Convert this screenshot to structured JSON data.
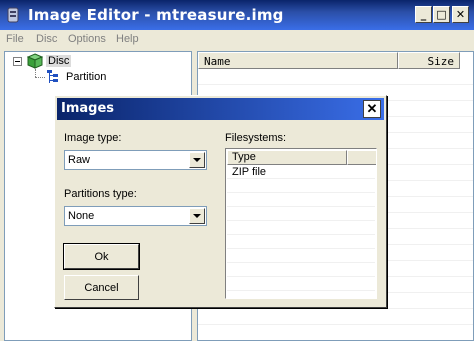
{
  "window": {
    "title": "Image Editor - mtreasure.img",
    "minimize_glyph": "_",
    "maximize_glyph": "□",
    "close_glyph": "✕"
  },
  "menu": {
    "items": [
      "File",
      "Disc",
      "Options",
      "Help"
    ],
    "state": "disabled"
  },
  "tree": {
    "root": {
      "label": "Disc",
      "expanded": true,
      "icon": "disc-cube-icon"
    },
    "children": [
      {
        "label": "Partition",
        "icon": "partition-tree-icon"
      }
    ]
  },
  "list": {
    "columns": [
      "Name",
      "Size"
    ],
    "rows": []
  },
  "dialog": {
    "title": "Images",
    "image_type_label": "Image type:",
    "image_type_value": "Raw",
    "partitions_type_label": "Partitions type:",
    "partitions_type_value": "None",
    "ok_label": "Ok",
    "cancel_label": "Cancel",
    "filesystems_label": "Filesystems:",
    "filesystems_columns": [
      "Type",
      ""
    ],
    "filesystems_rows": [
      "ZIP file"
    ]
  },
  "colors": {
    "titlebar": "#0a246a",
    "face": "#ece9d8",
    "disabled_text": "#808080"
  }
}
